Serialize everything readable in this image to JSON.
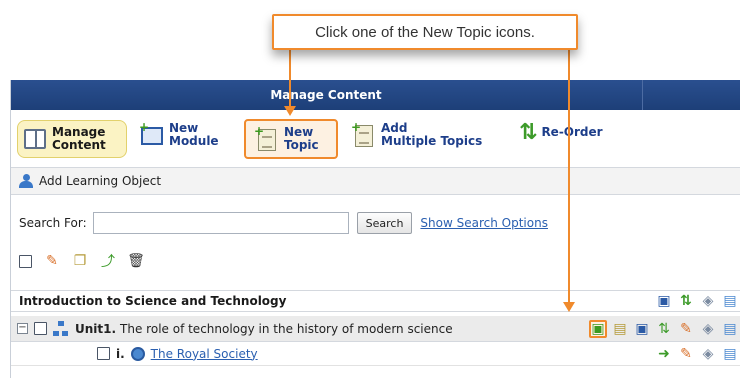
{
  "callout": {
    "text": "Click one of the New Topic icons."
  },
  "window": {
    "title": "Manage Content"
  },
  "toolbar": {
    "manage_content": "Manage\nContent",
    "manage_line1": "Manage",
    "manage_line2": "Content",
    "new_module_line1": "New",
    "new_module_line2": "Module",
    "new_topic_line1": "New",
    "new_topic_line2": "Topic",
    "add_multi_line1": "Add",
    "add_multi_line2": "Multiple Topics",
    "reorder": "Re-Order"
  },
  "add_learning_object": "Add Learning Object",
  "search": {
    "label": "Search For:",
    "value": "",
    "button": "Search",
    "options_link": "Show Search Options"
  },
  "tree": {
    "course": "Introduction to Science and Technology",
    "unit_number": "Unit1.",
    "unit_title": "The role of technology in the history of modern science",
    "item_number": "i.",
    "item_title": "The Royal Society"
  },
  "colors": {
    "header_bg": "#1d3f78",
    "highlight": "#f08a2c",
    "link": "#2a5fb0",
    "selected_bg": "#fbf3c4"
  }
}
